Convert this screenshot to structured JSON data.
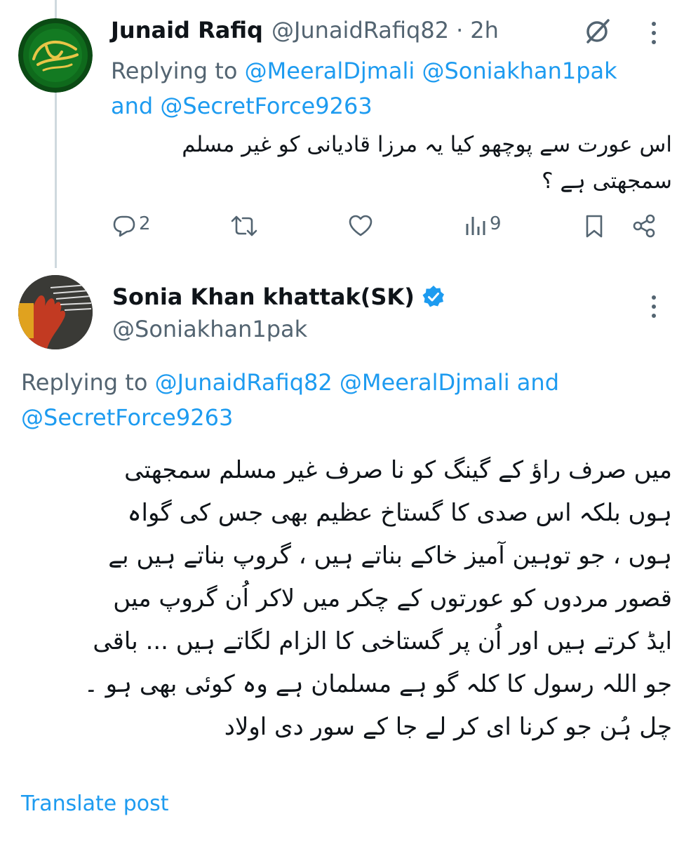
{
  "colors": {
    "link": "#1d9bf0",
    "secondary": "#536471",
    "verified": "#1d9bf0"
  },
  "tweet1": {
    "name": "Junaid Rafiq",
    "handle": "@JunaidRafiq82",
    "separator": "·",
    "time": "2h",
    "replying_prefix": "Replying to",
    "mention1": "@MeeralDjmali",
    "mention2": "@Soniakhan1pak",
    "and": "and",
    "mention3": "@SecretForce9263",
    "text_line1": "اس عورت سے پوچھو کیا یہ مرزا قادیانی کو غیر مسلم",
    "text_line2": "سمجھتی ہے ؟",
    "replies": "2",
    "views": "9"
  },
  "tweet2": {
    "name": "Sonia Khan khattak(SK)",
    "handle": "@Soniakhan1pak",
    "replying_prefix": "Replying to",
    "mention1": "@JunaidRafiq82",
    "mention2": "@MeeralDjmali",
    "and": "and",
    "mention3": "@SecretForce9263",
    "lines": [
      "میں صرف راؤ کے گینگ کو نا صرف غیر مسلم سمجھتی",
      "ہوں بلکہ اس صدی کا گستاخ عظیم بھی جس کی گواہ",
      "ہوں ، جو توہین آمیز خاکے بناتے ہیں ، گروپ بناتے ہیں بے",
      "قصور مردوں کو عورتوں کے چکر میں لاکر اُن گروپ میں",
      "ایڈ کرتے ہیں اور اُن پر گستاخی کا الزام لگاتے ہیں ... باقی",
      "جو اللہ رسول کا کلہ گو ہے مسلمان ہے وہ کوئی بھی ہو ۔",
      "چل ہُن جو کرنا ای کر لے جا کے سور دی اولاد"
    ],
    "translate": "Translate post"
  }
}
